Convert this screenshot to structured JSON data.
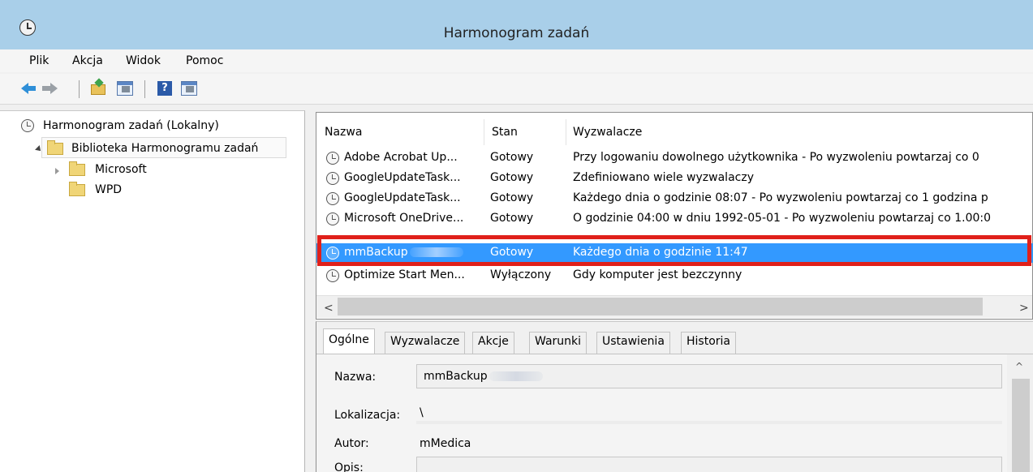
{
  "window": {
    "title": "Harmonogram zadań",
    "icon": "clock-icon"
  },
  "menu": [
    {
      "label": "Plik"
    },
    {
      "label": "Akcja"
    },
    {
      "label": "Widok"
    },
    {
      "label": "Pomoc"
    }
  ],
  "toolbar": {
    "buttons": [
      "back-icon",
      "forward-icon",
      "up-folder-icon",
      "show-hide-console-tree-icon",
      "help-icon",
      "show-hide-action-pane-icon"
    ]
  },
  "tree": {
    "root": "Harmonogram zadań (Lokalny)",
    "library": "Biblioteka Harmonogramu zadań",
    "children": [
      {
        "label": "Microsoft",
        "expandable": true
      },
      {
        "label": "WPD",
        "expandable": false
      }
    ]
  },
  "task_list": {
    "columns": [
      "Nazwa",
      "Stan",
      "Wyzwalacze"
    ],
    "rows": [
      {
        "name": "Adobe Acrobat Up...",
        "state": "Gotowy",
        "trigger": "Przy logowaniu dowolnego użytkownika - Po wyzwoleniu powtarzaj co 0"
      },
      {
        "name": "GoogleUpdateTask...",
        "state": "Gotowy",
        "trigger": "Zdefiniowano wiele wyzwalaczy"
      },
      {
        "name": "GoogleUpdateTask...",
        "state": "Gotowy",
        "trigger": "Każdego dnia o godzinie 08:07 - Po wyzwoleniu powtarzaj co 1 godzina p"
      },
      {
        "name": "Microsoft OneDrive...",
        "state": "Gotowy",
        "trigger": "O godzinie 04:00 w dniu 1992-05-01 - Po wyzwoleniu powtarzaj co 1.00:0"
      },
      {
        "name": "mmBackup",
        "state": "Gotowy",
        "trigger": "Każdego dnia o godzinie 11:47",
        "selected": true
      },
      {
        "name": "Optimize Start Men...",
        "state": "Wyłączony",
        "trigger": "Gdy komputer jest bezczynny"
      }
    ],
    "scroll_left": "<",
    "scroll_right": ">"
  },
  "detail": {
    "tabs": [
      "Ogólne",
      "Wyzwalacze",
      "Akcje",
      "Warunki",
      "Ustawienia",
      "Historia"
    ],
    "active_tab": "Ogólne",
    "fields": {
      "name_label": "Nazwa:",
      "name_value": "mmBackup",
      "location_label": "Lokalizacja:",
      "location_value": "\\",
      "author_label": "Autor:",
      "author_value": "mMedica",
      "description_label": "Opis:"
    },
    "scroll_up": "^"
  },
  "colors": {
    "titlebar": "#a9cfe9",
    "selection": "#3399ff",
    "highlight_border": "#e0201a"
  }
}
